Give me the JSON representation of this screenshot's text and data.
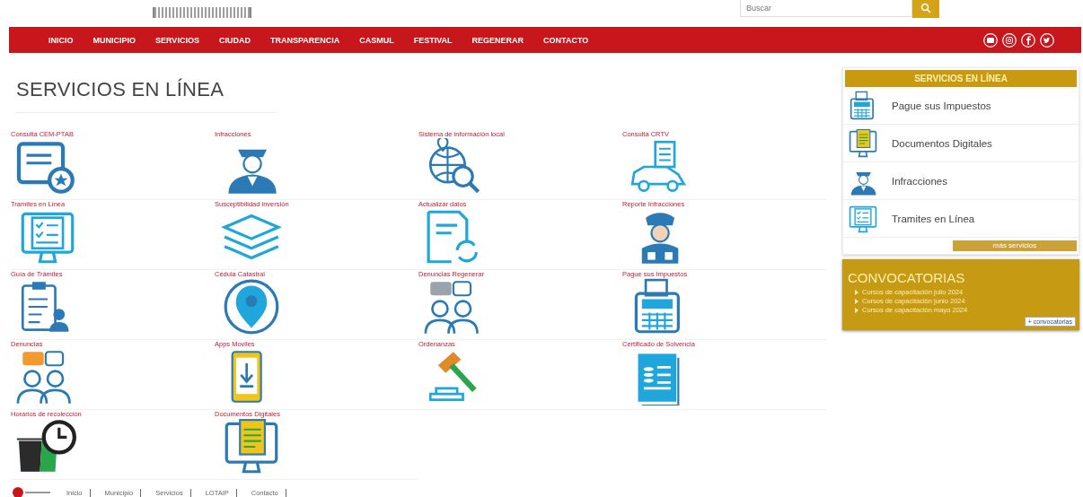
{
  "header": {
    "search": {
      "placeholder": "Buscar"
    }
  },
  "nav": {
    "items": [
      "INICIO",
      "MUNICIPIO",
      "SERVICIOS",
      "CIUDAD",
      "TRANSPARENCIA",
      "CASMUL",
      "FESTIVAL",
      "REGENERAR",
      "CONTACTO"
    ]
  },
  "page_title": "SERVICIOS EN LÍNEA",
  "services": [
    {
      "label": "Consulta CEM-PTAB"
    },
    {
      "label": "Infracciones"
    },
    {
      "label": "Sistema de información local"
    },
    {
      "label": "Consulta CRTV"
    },
    {
      "label": "Tramites en Línea"
    },
    {
      "label": "Susceptibilidad inversión"
    },
    {
      "label": "Actualizar datos"
    },
    {
      "label": "Reporte Infracciones"
    },
    {
      "label": "Guía de Trámites"
    },
    {
      "label": "Cédula Catastral"
    },
    {
      "label": "Denuncias Regenerar"
    },
    {
      "label": "Pague sus Impuestos"
    },
    {
      "label": "Denuncias"
    },
    {
      "label": "Apps Moviles"
    },
    {
      "label": "Ordenanzas"
    },
    {
      "label": "Certificado de Solvencia"
    },
    {
      "label": "Horarios de recolección"
    },
    {
      "label": "Documentos Digitales"
    }
  ],
  "sidebar": {
    "title": "SERVICIOS EN LÍNEA",
    "items": [
      "Pague sus Impuestos",
      "Documentos Digitales",
      "Infracciones",
      "Tramites en Línea"
    ],
    "more_button": "más servicios",
    "convocatorias": {
      "title": "CONVOCATORIAS",
      "items": [
        "Cursos de capacitación julio 2024",
        "Cursos de capacitación junio 2024",
        "Cursos de capacitación mayo 2024"
      ],
      "button": "+ convocatorias"
    }
  },
  "footer": {
    "links": [
      "Inicio",
      "Municipio",
      "Servicios",
      "LOTAIP",
      "Contacto"
    ]
  }
}
